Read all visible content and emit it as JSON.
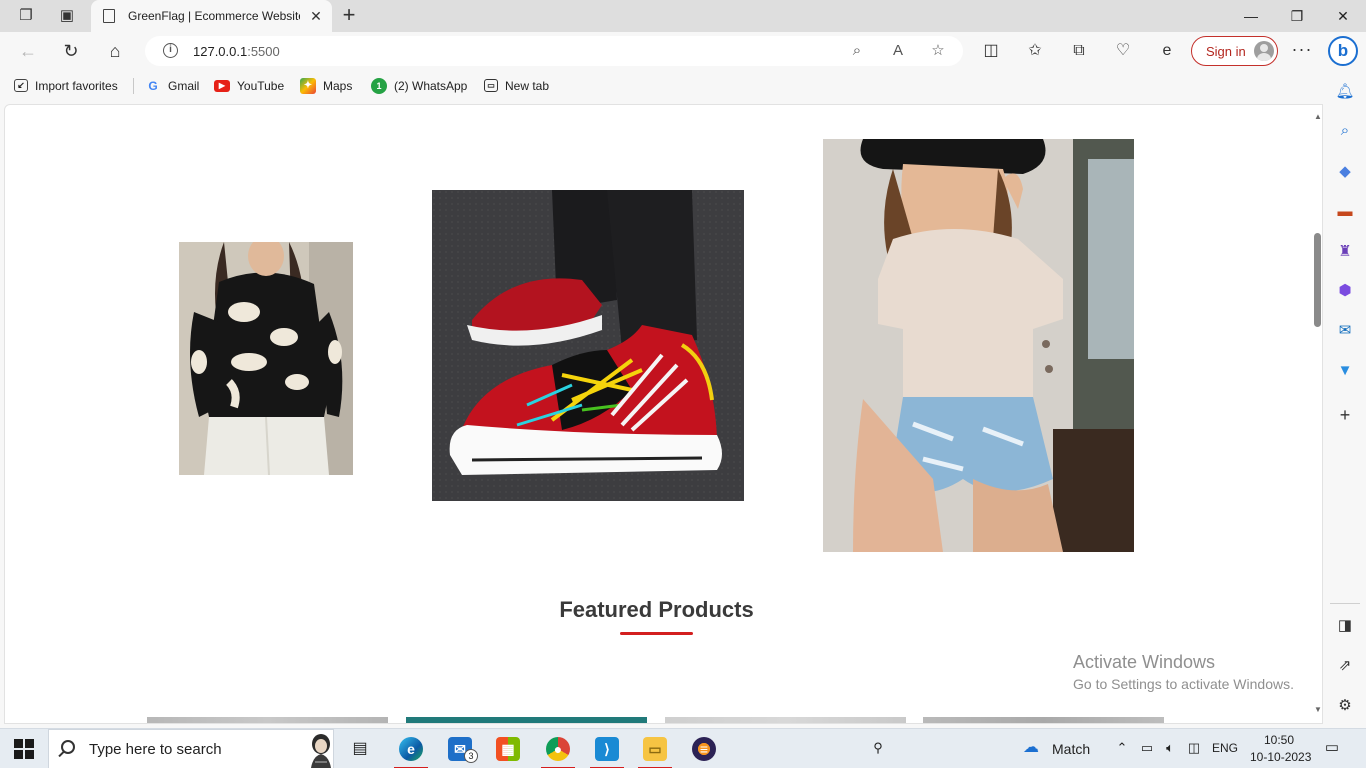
{
  "browser": {
    "tab_title": "GreenFlag | Ecommerce Website",
    "url_host": "127.0.0.1",
    "url_port": ":5500",
    "sign_in_label": "Sign in",
    "accent_color": "#b3261e"
  },
  "favorites": [
    {
      "label": "Import favorites",
      "icon": "import-icon"
    },
    {
      "label": "Gmail",
      "icon": "google-icon"
    },
    {
      "label": "YouTube",
      "icon": "youtube-icon"
    },
    {
      "label": "Maps",
      "icon": "maps-icon"
    },
    {
      "label": "(2) WhatsApp",
      "icon": "whatsapp-icon"
    },
    {
      "label": "New tab",
      "icon": "new-tab-icon"
    }
  ],
  "page": {
    "section_title": "Featured Products",
    "underline_color": "#d31f1f",
    "carousel_images": [
      "shirt-photo",
      "sneaker-photo",
      "tshirt-photo"
    ]
  },
  "watermark": {
    "title": "Activate Windows",
    "subtitle": "Go to Settings to activate Windows."
  },
  "taskbar": {
    "search_placeholder": "Type here to search",
    "mail_badge": "3",
    "weather_label": "Match",
    "language": "ENG",
    "time": "10:50",
    "date": "10-10-2023"
  }
}
